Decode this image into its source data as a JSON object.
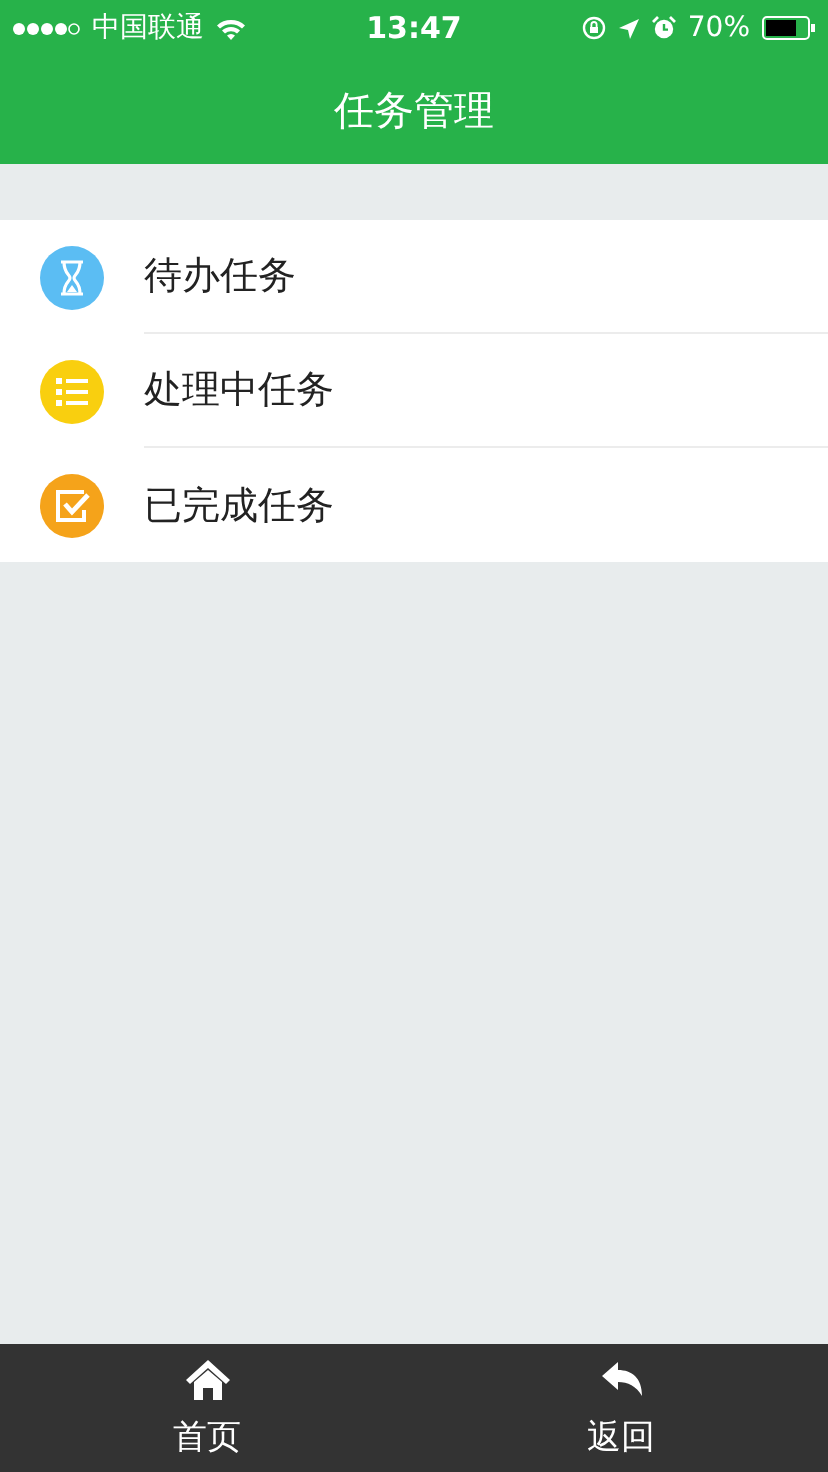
{
  "status_bar": {
    "carrier": "中国联通",
    "time": "13:47",
    "battery": "70%"
  },
  "nav_bar": {
    "title": "任务管理"
  },
  "menu": [
    {
      "kind": "pending",
      "label": "待办任务"
    },
    {
      "kind": "in_progress",
      "label": "处理中任务"
    },
    {
      "kind": "done",
      "label": "已完成任务"
    }
  ],
  "tab_bar": [
    {
      "kind": "home",
      "label": "首页"
    },
    {
      "kind": "back",
      "label": "返回"
    }
  ]
}
